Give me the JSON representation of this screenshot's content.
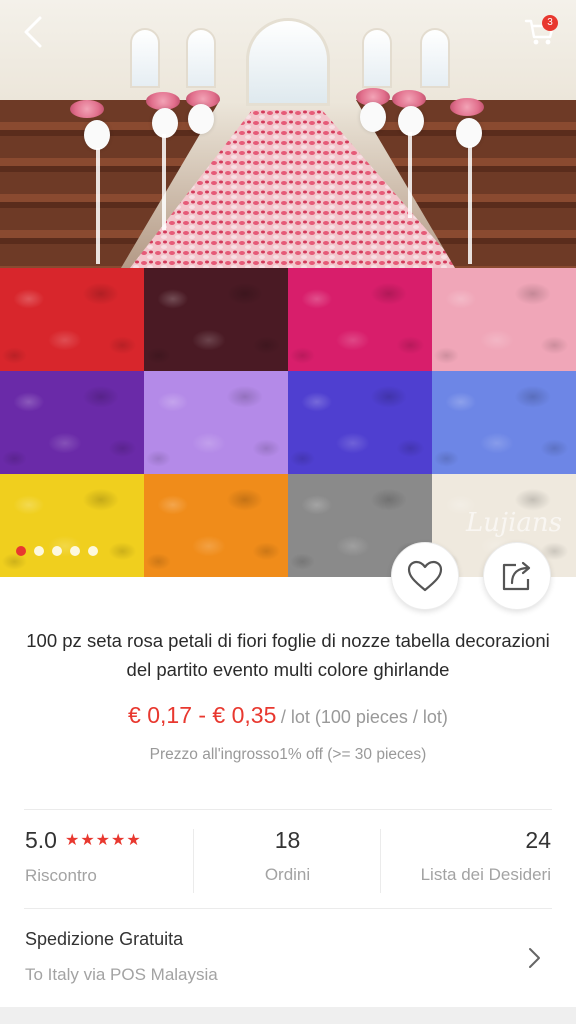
{
  "header": {
    "back_icon": "chevron-left-icon",
    "cart_icon": "cart-icon",
    "cart_count": "3"
  },
  "gallery": {
    "petal_colors": [
      "#d8262c",
      "#4a1a24",
      "#d81e6b",
      "#f0a6b8",
      "#6a2aa8",
      "#b48ae8",
      "#4f3fd0",
      "#6d86e6",
      "#f0cf1e",
      "#f08c1a",
      "#8a8a8a",
      "#efe9de"
    ],
    "slide_count": 5,
    "active_slide": 1,
    "watermark": "Lujians"
  },
  "actions": {
    "wishlist_icon": "heart-icon",
    "share_icon": "share-icon"
  },
  "product": {
    "title": "100 pz seta rosa petali di fiori foglie di nozze tabella decorazioni del partito evento multi colore ghirlande",
    "price": "€ 0,17 - € 0,35",
    "price_unit": "/ lot (100 pieces / lot)",
    "wholesale": "Prezzo all'ingrosso1% off (>= 30 pieces)"
  },
  "stats": {
    "rating_value": "5.0",
    "rating_stars": "★★★★★",
    "rating_label": "Riscontro",
    "orders_value": "18",
    "orders_label": "Ordini",
    "wishlist_value": "24",
    "wishlist_label": "Lista dei Desideri"
  },
  "shipping": {
    "title": "Spedizione Gratuita",
    "subtitle": "To Italy via POS Malaysia",
    "chevron_icon": "chevron-right-icon"
  },
  "colors": {
    "accent": "#e8382f",
    "muted": "#a3a3a3"
  }
}
